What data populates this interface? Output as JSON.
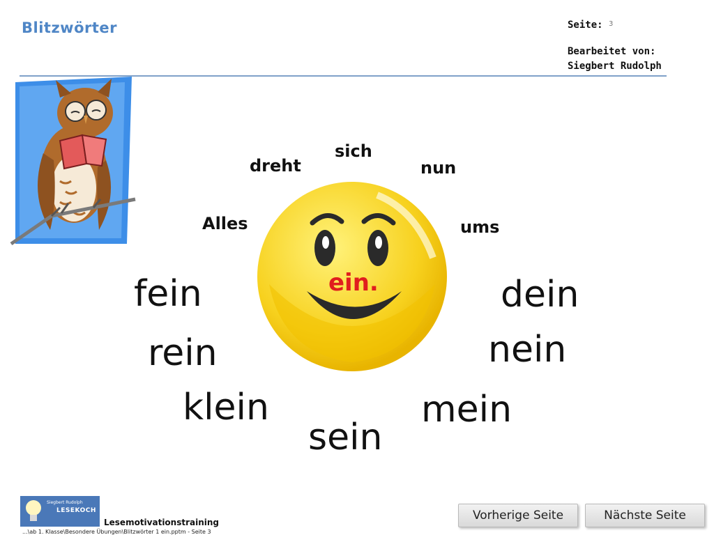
{
  "header": {
    "title": "Blitzwörter",
    "page_label": "Seite:",
    "page_number": "3",
    "edited_by_label": "Bearbeitet von:",
    "author": "Siegbert Rudolph"
  },
  "words": {
    "small": [
      "sich",
      "dreht",
      "nun",
      "Alles",
      "ums"
    ],
    "center": "ein.",
    "big": [
      "fein",
      "dein",
      "rein",
      "nein",
      "klein",
      "mein",
      "sein"
    ]
  },
  "footer": {
    "logo_small": "Siegbert Rudolph",
    "logo_brand": "LESEKOCH",
    "training_label": "Lesemotivationstraining",
    "path": "...\\ab 1. Klasse\\Besondere Übungen\\Blitzwörter 1 ein.pptm - Seite 3"
  },
  "nav": {
    "prev_label": "Vorherige Seite",
    "next_label": "Nächste Seite"
  },
  "colors": {
    "title_blue": "#4f86c6",
    "smiley_yellow": "#f7d11e",
    "center_red": "#e01e1e"
  },
  "icons": {
    "owl": "owl-reading-icon",
    "smiley": "smiley-face-icon",
    "logo": "lightbulb-logo-icon"
  }
}
